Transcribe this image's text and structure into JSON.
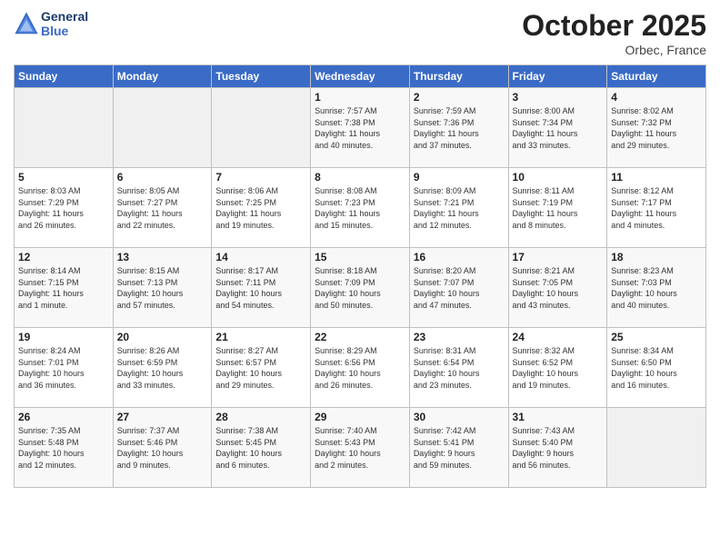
{
  "header": {
    "logo_line1": "General",
    "logo_line2": "Blue",
    "month": "October 2025",
    "location": "Orbec, France"
  },
  "days_of_week": [
    "Sunday",
    "Monday",
    "Tuesday",
    "Wednesday",
    "Thursday",
    "Friday",
    "Saturday"
  ],
  "weeks": [
    [
      {
        "day": "",
        "info": ""
      },
      {
        "day": "",
        "info": ""
      },
      {
        "day": "",
        "info": ""
      },
      {
        "day": "1",
        "info": "Sunrise: 7:57 AM\nSunset: 7:38 PM\nDaylight: 11 hours\nand 40 minutes."
      },
      {
        "day": "2",
        "info": "Sunrise: 7:59 AM\nSunset: 7:36 PM\nDaylight: 11 hours\nand 37 minutes."
      },
      {
        "day": "3",
        "info": "Sunrise: 8:00 AM\nSunset: 7:34 PM\nDaylight: 11 hours\nand 33 minutes."
      },
      {
        "day": "4",
        "info": "Sunrise: 8:02 AM\nSunset: 7:32 PM\nDaylight: 11 hours\nand 29 minutes."
      }
    ],
    [
      {
        "day": "5",
        "info": "Sunrise: 8:03 AM\nSunset: 7:29 PM\nDaylight: 11 hours\nand 26 minutes."
      },
      {
        "day": "6",
        "info": "Sunrise: 8:05 AM\nSunset: 7:27 PM\nDaylight: 11 hours\nand 22 minutes."
      },
      {
        "day": "7",
        "info": "Sunrise: 8:06 AM\nSunset: 7:25 PM\nDaylight: 11 hours\nand 19 minutes."
      },
      {
        "day": "8",
        "info": "Sunrise: 8:08 AM\nSunset: 7:23 PM\nDaylight: 11 hours\nand 15 minutes."
      },
      {
        "day": "9",
        "info": "Sunrise: 8:09 AM\nSunset: 7:21 PM\nDaylight: 11 hours\nand 12 minutes."
      },
      {
        "day": "10",
        "info": "Sunrise: 8:11 AM\nSunset: 7:19 PM\nDaylight: 11 hours\nand 8 minutes."
      },
      {
        "day": "11",
        "info": "Sunrise: 8:12 AM\nSunset: 7:17 PM\nDaylight: 11 hours\nand 4 minutes."
      }
    ],
    [
      {
        "day": "12",
        "info": "Sunrise: 8:14 AM\nSunset: 7:15 PM\nDaylight: 11 hours\nand 1 minute."
      },
      {
        "day": "13",
        "info": "Sunrise: 8:15 AM\nSunset: 7:13 PM\nDaylight: 10 hours\nand 57 minutes."
      },
      {
        "day": "14",
        "info": "Sunrise: 8:17 AM\nSunset: 7:11 PM\nDaylight: 10 hours\nand 54 minutes."
      },
      {
        "day": "15",
        "info": "Sunrise: 8:18 AM\nSunset: 7:09 PM\nDaylight: 10 hours\nand 50 minutes."
      },
      {
        "day": "16",
        "info": "Sunrise: 8:20 AM\nSunset: 7:07 PM\nDaylight: 10 hours\nand 47 minutes."
      },
      {
        "day": "17",
        "info": "Sunrise: 8:21 AM\nSunset: 7:05 PM\nDaylight: 10 hours\nand 43 minutes."
      },
      {
        "day": "18",
        "info": "Sunrise: 8:23 AM\nSunset: 7:03 PM\nDaylight: 10 hours\nand 40 minutes."
      }
    ],
    [
      {
        "day": "19",
        "info": "Sunrise: 8:24 AM\nSunset: 7:01 PM\nDaylight: 10 hours\nand 36 minutes."
      },
      {
        "day": "20",
        "info": "Sunrise: 8:26 AM\nSunset: 6:59 PM\nDaylight: 10 hours\nand 33 minutes."
      },
      {
        "day": "21",
        "info": "Sunrise: 8:27 AM\nSunset: 6:57 PM\nDaylight: 10 hours\nand 29 minutes."
      },
      {
        "day": "22",
        "info": "Sunrise: 8:29 AM\nSunset: 6:56 PM\nDaylight: 10 hours\nand 26 minutes."
      },
      {
        "day": "23",
        "info": "Sunrise: 8:31 AM\nSunset: 6:54 PM\nDaylight: 10 hours\nand 23 minutes."
      },
      {
        "day": "24",
        "info": "Sunrise: 8:32 AM\nSunset: 6:52 PM\nDaylight: 10 hours\nand 19 minutes."
      },
      {
        "day": "25",
        "info": "Sunrise: 8:34 AM\nSunset: 6:50 PM\nDaylight: 10 hours\nand 16 minutes."
      }
    ],
    [
      {
        "day": "26",
        "info": "Sunrise: 7:35 AM\nSunset: 5:48 PM\nDaylight: 10 hours\nand 12 minutes."
      },
      {
        "day": "27",
        "info": "Sunrise: 7:37 AM\nSunset: 5:46 PM\nDaylight: 10 hours\nand 9 minutes."
      },
      {
        "day": "28",
        "info": "Sunrise: 7:38 AM\nSunset: 5:45 PM\nDaylight: 10 hours\nand 6 minutes."
      },
      {
        "day": "29",
        "info": "Sunrise: 7:40 AM\nSunset: 5:43 PM\nDaylight: 10 hours\nand 2 minutes."
      },
      {
        "day": "30",
        "info": "Sunrise: 7:42 AM\nSunset: 5:41 PM\nDaylight: 9 hours\nand 59 minutes."
      },
      {
        "day": "31",
        "info": "Sunrise: 7:43 AM\nSunset: 5:40 PM\nDaylight: 9 hours\nand 56 minutes."
      },
      {
        "day": "",
        "info": ""
      }
    ]
  ]
}
